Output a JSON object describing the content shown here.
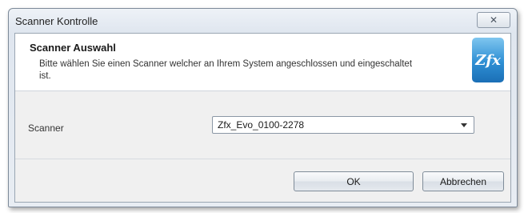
{
  "window": {
    "title": "Scanner Kontrolle",
    "close_glyph": "✕"
  },
  "header": {
    "title": "Scanner Auswahl",
    "description": "Bitte wählen Sie einen Scanner welcher an Ihrem System angeschlossen und eingeschaltet ist.",
    "logo_text": "Zfx",
    "logo_color": "#2e8fd4"
  },
  "form": {
    "scanner_label": "Scanner",
    "scanner_selected": "Zfx_Evo_0100-2278"
  },
  "buttons": {
    "ok": "OK",
    "cancel": "Abbrechen"
  }
}
